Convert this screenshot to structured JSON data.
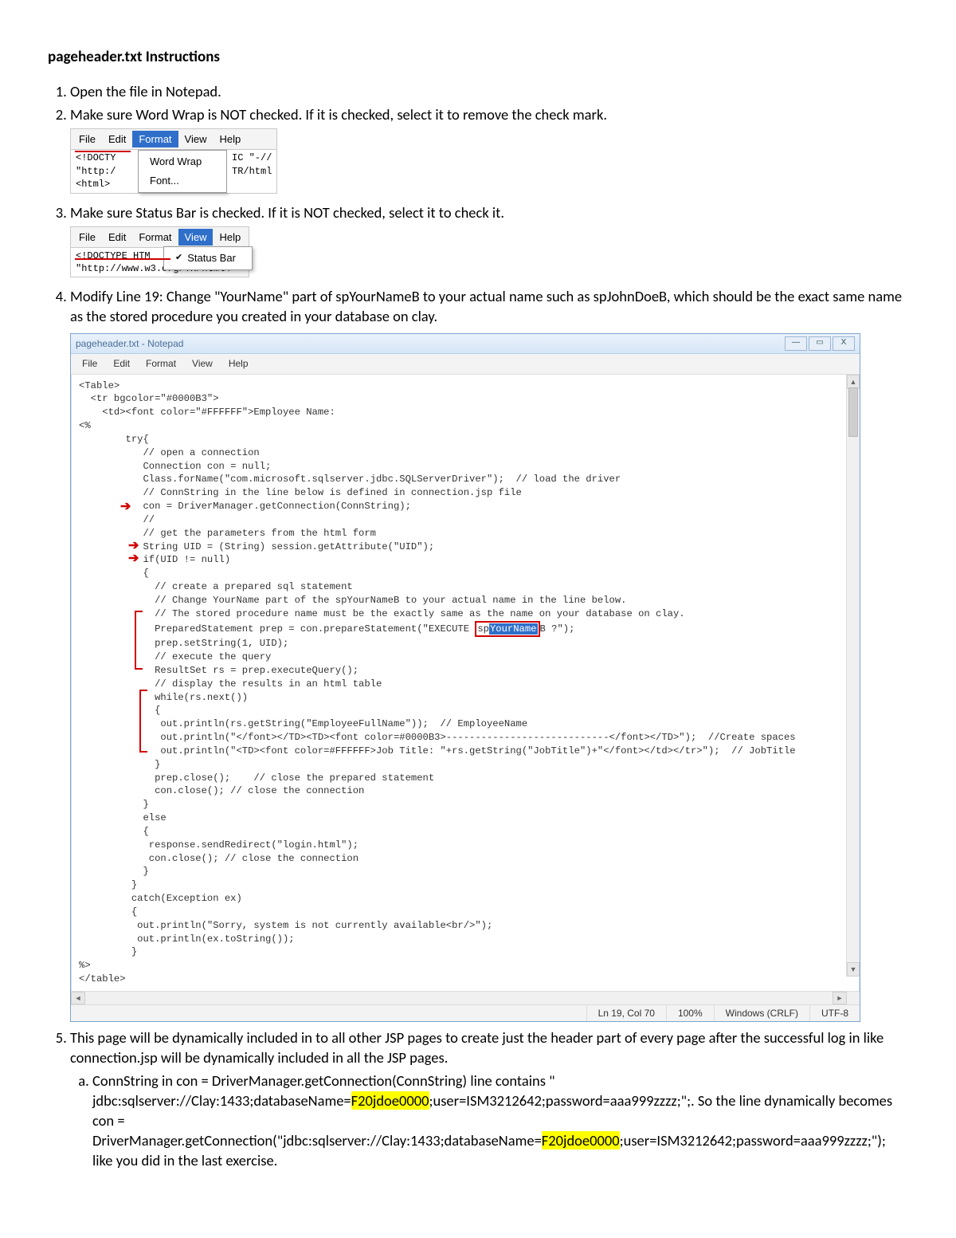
{
  "title": "pageheader.txt Instructions",
  "steps": {
    "s1": "Open the file in Notepad.",
    "s2": "Make sure Word Wrap is NOT checked. If it is checked, select it to remove the check mark.",
    "s3": "Make sure Status Bar is checked.  If it is NOT checked, select it to check it.",
    "s4": "Modify Line 19: Change \"YourName\" part of spYourNameB to your actual name such as spJohnDoeB, which should be the exact same name as the stored procedure you created in your database on clay.",
    "s5": "This page will be dynamically included in to all other JSP pages to create just the header part of every page after the successful log in like connection.jsp will be dynamically included in all the JSP pages.",
    "s5a_pre": "ConnString in con = DriverManager.getConnection(ConnString) line contains \" jdbc:sqlserver://Clay:1433;databaseName=",
    "s5a_h1": "F20jdoe0000",
    "s5a_mid": ";user=ISM3212642;password=aaa999zzzz;\";. So the line dynamically becomes con = DriverManager.getConnection(\"jdbc:sqlserver://Clay:1433;databaseName=",
    "s5a_h2": "F20jdoe0000",
    "s5a_post": ";user=ISM3212642;password=aaa999zzzz;\"); like you did in the last exercise."
  },
  "mini_format": {
    "menus": {
      "file": "File",
      "edit": "Edit",
      "format": "Format",
      "view": "View",
      "help": "Help"
    },
    "items": {
      "wordwrap": "Word Wrap",
      "font": "Font..."
    },
    "left_text": "<!DOCTY\n\"http:/\n<html>",
    "right_text": "IC \"-//\nTR/html"
  },
  "mini_view": {
    "menus": {
      "file": "File",
      "edit": "Edit",
      "format": "Format",
      "view": "View",
      "help": "Help"
    },
    "item": "Status Bar",
    "line1": "<!DOCTYPE HTM",
    "line2": "\"http://www.w3.org/TR/html4"
  },
  "big": {
    "title": "pageheader.txt - Notepad",
    "menus": {
      "file": "File",
      "edit": "Edit",
      "format": "Format",
      "view": "View",
      "help": "Help"
    },
    "winbtns": {
      "min": "—",
      "max": "▭",
      "close": "X"
    },
    "status": {
      "pos": "Ln 19, Col 70",
      "zoom": "100%",
      "eol": "Windows (CRLF)",
      "enc": "UTF-8"
    },
    "hl_before": "PreparedStatement prep = con.prepareStatement(\"EXECUTE ",
    "hl_sp": "sp",
    "hl_sel": "YourName",
    "hl_after": "B ?\");",
    "code_top": "<Table>\n  <tr bgcolor=\"#0000B3\">\n    <td><font color=\"#FFFFFF\">Employee Name:\n<%\n        try{\n           // open a connection\n           Connection con = null;\n           Class.forName(\"com.microsoft.sqlserver.jdbc.SQLServerDriver\");  // load the driver\n           // ConnString in the line below is defined in connection.jsp file\n           con = DriverManager.getConnection(ConnString);\n           //\n           // get the parameters from the html form\n           String UID = (String) session.getAttribute(\"UID\");\n           if(UID != null)\n           {\n             // create a prepared sql statement\n             // Change YourName part of the spYourNameB to your actual name in the line below.\n             // The stored procedure name must be the exactly same as the name on your database on clay.",
    "code_mid": "             prep.setString(1, UID);\n             // execute the query\n             ResultSet rs = prep.executeQuery();\n             // display the results in an html table\n             while(rs.next())\n             {\n              out.println(rs.getString(\"EmployeeFullName\"));  // EmployeeName\n              out.println(\"</font></TD><TD><font color=#0000B3>----------------------------</font></TD>\");  //Create spaces\n              out.println(\"<TD><font color=#FFFFFF>Job Title: \"+rs.getString(\"JobTitle\")+\"</font></td></tr>\");  // JobTitle\n             }\n             prep.close();    // close the prepared statement\n             con.close(); // close the connection\n           }\n           else\n           {\n            response.sendRedirect(\"login.html\");\n            con.close(); // close the connection\n           }\n         }\n         catch(Exception ex)\n         {\n          out.println(\"Sorry, system is not currently available<br/>\");\n          out.println(ex.toString());\n         }\n%>\n</table>"
  }
}
